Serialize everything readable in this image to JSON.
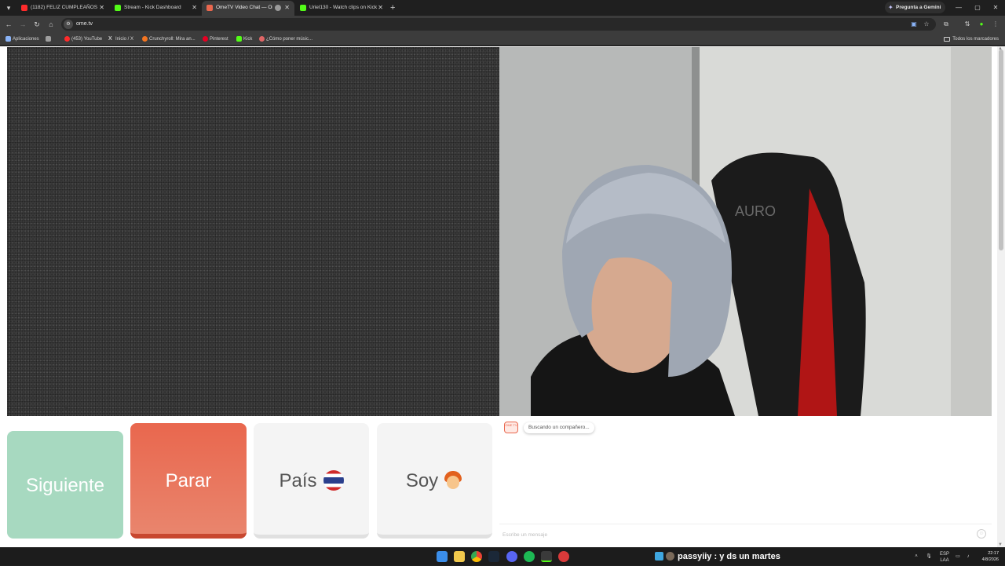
{
  "browser": {
    "tabs": [
      {
        "title": "(1182) FELIZ CUMPLEAÑOS OR...",
        "favicon_color": "#ff2b2b",
        "active": false
      },
      {
        "title": "Stream - Kick Dashboard",
        "favicon_color": "#53fc18",
        "active": false
      },
      {
        "title": "OmeTV Video Chat — Ome...",
        "favicon_color": "#e9674e",
        "active": true
      },
      {
        "title": "Uriel130 - Watch clips on Kick",
        "favicon_color": "#53fc18",
        "active": false
      }
    ],
    "gemini_label": "Pregunta a Gemini",
    "url": "ome.tv",
    "bookmarks": [
      {
        "label": "Aplicaciones",
        "color": "#8ab4f8"
      },
      {
        "label": "",
        "color": "#9e9e9e"
      },
      {
        "label": "(453) YouTube",
        "color": "#ff2b2b"
      },
      {
        "label": "Inicio / X",
        "color": "#ffffff"
      },
      {
        "label": "Crunchyroll: Mira an...",
        "color": "#f47521"
      },
      {
        "label": "Pinterest",
        "color": "#e60023"
      },
      {
        "label": "Kick",
        "color": "#53fc18"
      },
      {
        "label": "¿Cómo poner músic...",
        "color": "#e06666"
      }
    ],
    "all_bookmarks": "Todos los marcadores"
  },
  "page": {
    "buttons": {
      "next": "Siguiente",
      "stop": "Parar",
      "country": "País",
      "gender": "Soy"
    },
    "chat": {
      "logo_text": "OME TV",
      "status_message": "Buscando un compañero...",
      "input_placeholder": "Escribe un mensaje"
    }
  },
  "taskbar": {
    "stream_overlay": "passyiiy : y ds un martes",
    "language_top": "ESP",
    "language_bottom": "LAA",
    "time": "22:17",
    "date": "4/8/2026"
  }
}
